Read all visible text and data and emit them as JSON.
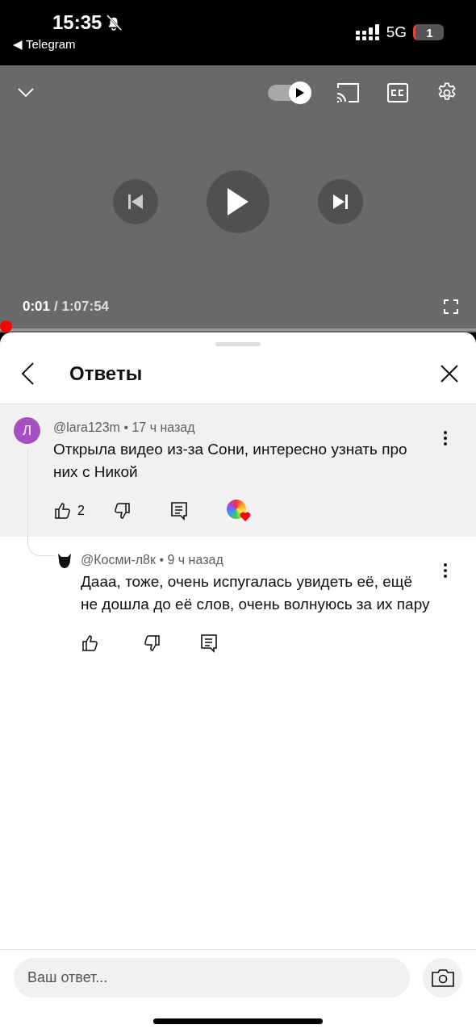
{
  "status_bar": {
    "time": "15:35",
    "back_app": "◀ Telegram",
    "network": "5G",
    "battery": "1",
    "muted": true
  },
  "player": {
    "autoplay_on": true,
    "current_time": "0:01",
    "duration": "/ 1:07:54",
    "progress": {
      "level": 0.0
    }
  },
  "sheet": {
    "title": "Ответы"
  },
  "comment": {
    "avatar_letter": "Л",
    "author": "@lara123m",
    "time": "• 17 ч назад",
    "text": "Открыла видео из-за Сони, интересно узнать про них с Никой",
    "likes": "2",
    "creator_heart": true,
    "highlighted": true,
    "replies": [
      {
        "kind": "icon",
        "author": "@Косми-л8к",
        "time": "• 9 ч назад",
        "text": "Дааа, тоже, очень испугалась увидеть её, ещё не дошла до её слов, очень волнуюсь за их пару",
        "creator_heart": false,
        "highlighted": false
      }
    ]
  },
  "reply_field": {
    "placeholder": "Ваш ответ..."
  }
}
